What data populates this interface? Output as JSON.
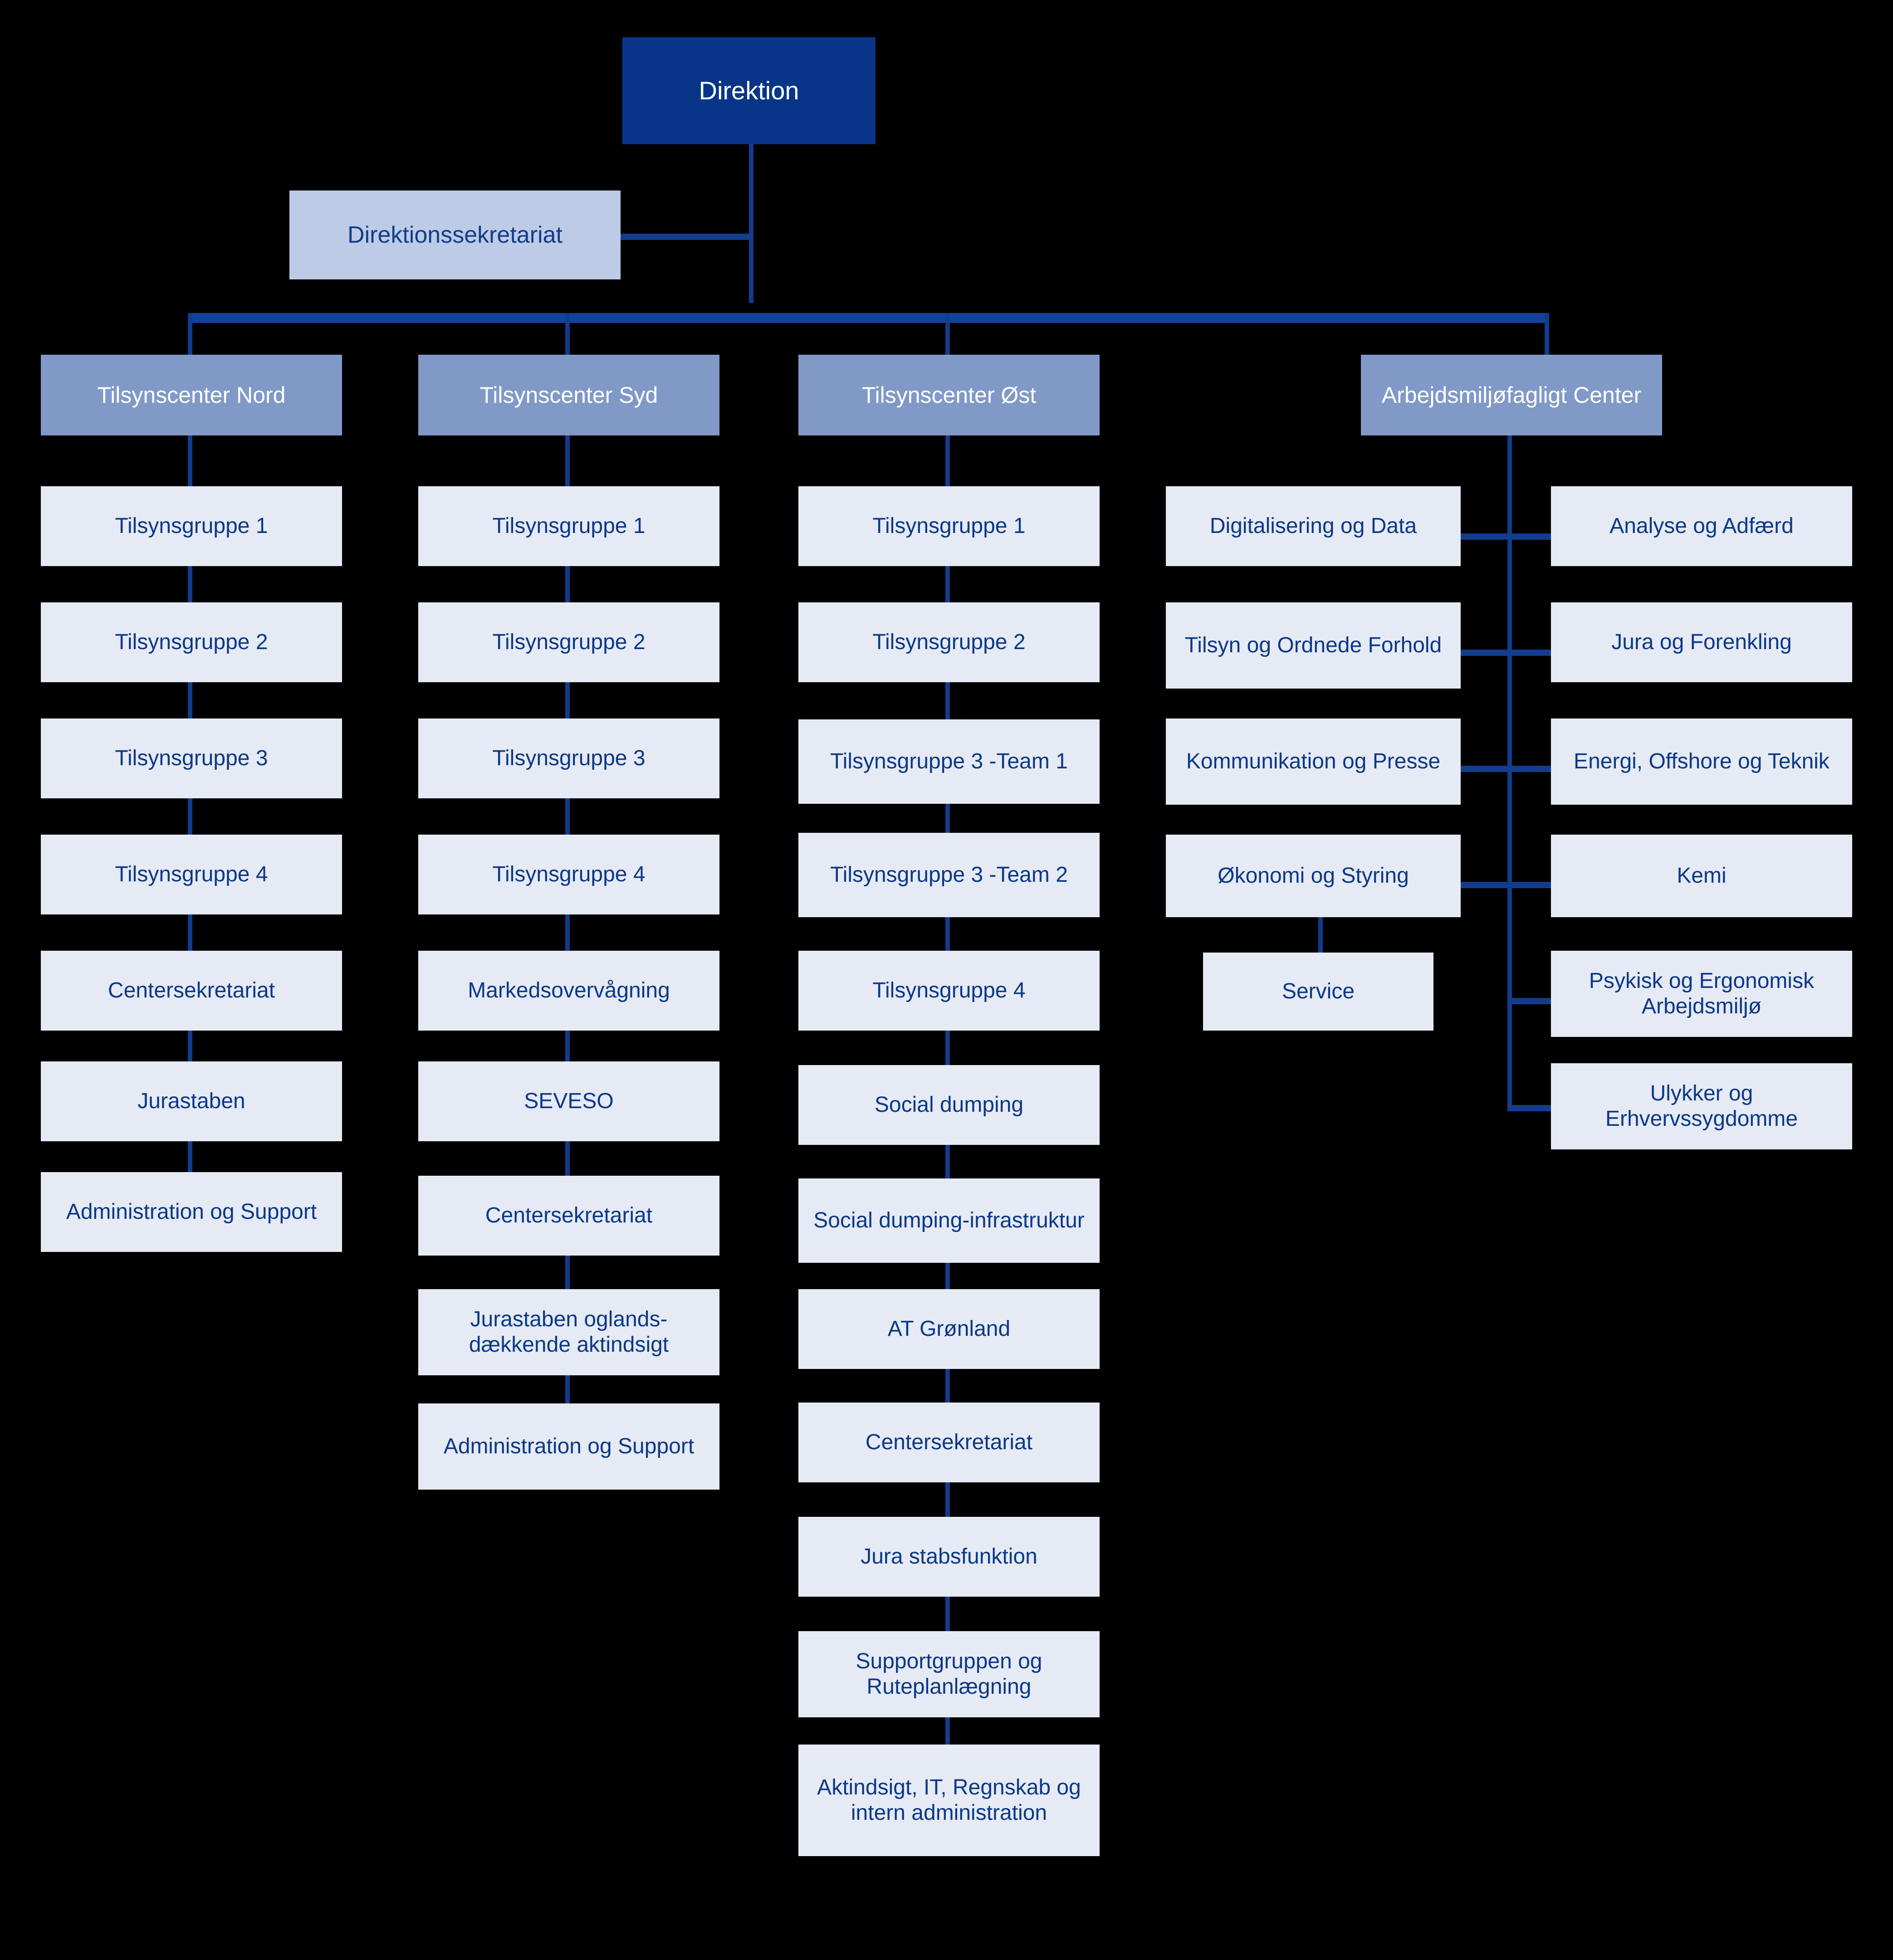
{
  "diagram": {
    "type": "org-chart",
    "title_node": "Direktion",
    "colors": {
      "background": "#000000",
      "root_fill": "#083587",
      "root_text": "#ffffff",
      "staff_fill": "#bdcbe6",
      "staff_text": "#123c8c",
      "center_fill": "#8099c7",
      "center_text": "#ffffff",
      "leaf_fill": "#e6eaf4",
      "leaf_text": "#0a3887",
      "connector": "#123c8c"
    }
  },
  "root": {
    "label": "Direktion"
  },
  "staff": {
    "label": "Direktionssekretariat"
  },
  "centers": [
    {
      "label": "Tilsynscenter Nord",
      "children": [
        "Tilsynsgruppe 1",
        "Tilsynsgruppe 2",
        "Tilsynsgruppe 3",
        "Tilsynsgruppe 4",
        "Centersekretariat",
        "Jurastaben",
        "Administration og Support"
      ]
    },
    {
      "label": "Tilsynscenter Syd",
      "children": [
        "Tilsynsgruppe 1",
        "Tilsynsgruppe 2",
        "Tilsynsgruppe 3",
        "Tilsynsgruppe 4",
        "Markedsovervågning",
        "SEVESO",
        "Centersekretariat",
        "Jurastaben oglands-dækkende  aktindsigt",
        "Administration og Support"
      ]
    },
    {
      "label": "Tilsynscenter Øst",
      "children": [
        "Tilsynsgruppe 1",
        "Tilsynsgruppe 2",
        "Tilsynsgruppe 3 -Team 1",
        "Tilsynsgruppe 3 -Team 2",
        "Tilsynsgruppe 4",
        "Social dumping",
        "Social dumping-infrastruktur",
        "AT Grønland",
        "Centersekretariat",
        "Jura stabsfunktion",
        "Supportgruppen og Ruteplanlægning",
        "Aktindsigt, IT, Regnskab og intern administration"
      ]
    },
    {
      "label": "Arbejdsmiljøfagligt Center",
      "left_children": [
        "Digitalisering og Data",
        "Tilsyn og Ordnede Forhold",
        "Kommunikation og Presse",
        "Økonomi og Styring"
      ],
      "left_sub": "Service",
      "right_children": [
        "Analyse og Adfærd",
        "Jura og Forenkling",
        "Energi, Offshore og Teknik",
        "Kemi",
        "Psykisk og Ergonomisk Arbejdsmiljø",
        "Ulykker og Erhvervssygdomme"
      ]
    }
  ]
}
